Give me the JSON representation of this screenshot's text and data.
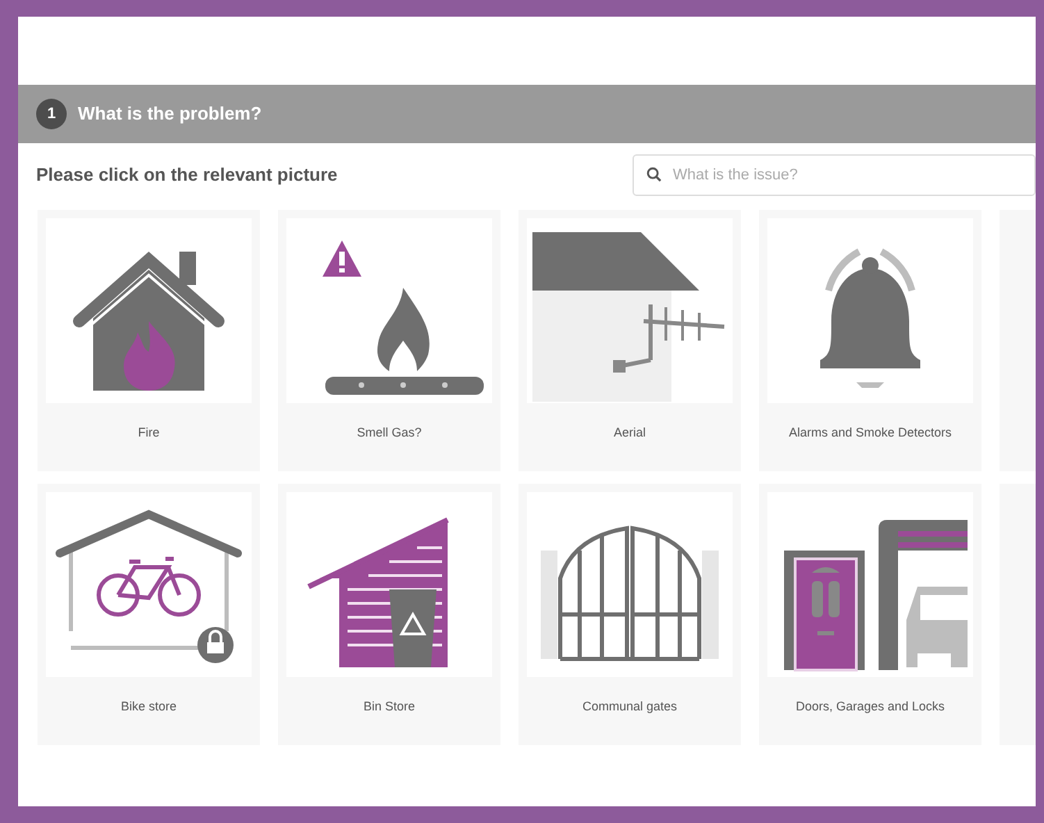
{
  "step": {
    "number": "1",
    "title": "What is the problem?"
  },
  "instruction": "Please click on the relevant picture",
  "search": {
    "placeholder": "What is the issue?"
  },
  "cards": [
    {
      "label": "Fire"
    },
    {
      "label": "Smell Gas?"
    },
    {
      "label": "Aerial"
    },
    {
      "label": "Alarms and Smoke Detectors"
    },
    {
      "label": "Bike store"
    },
    {
      "label": "Bin Store"
    },
    {
      "label": "Communal gates"
    },
    {
      "label": "Doors, Garages and Locks"
    }
  ]
}
